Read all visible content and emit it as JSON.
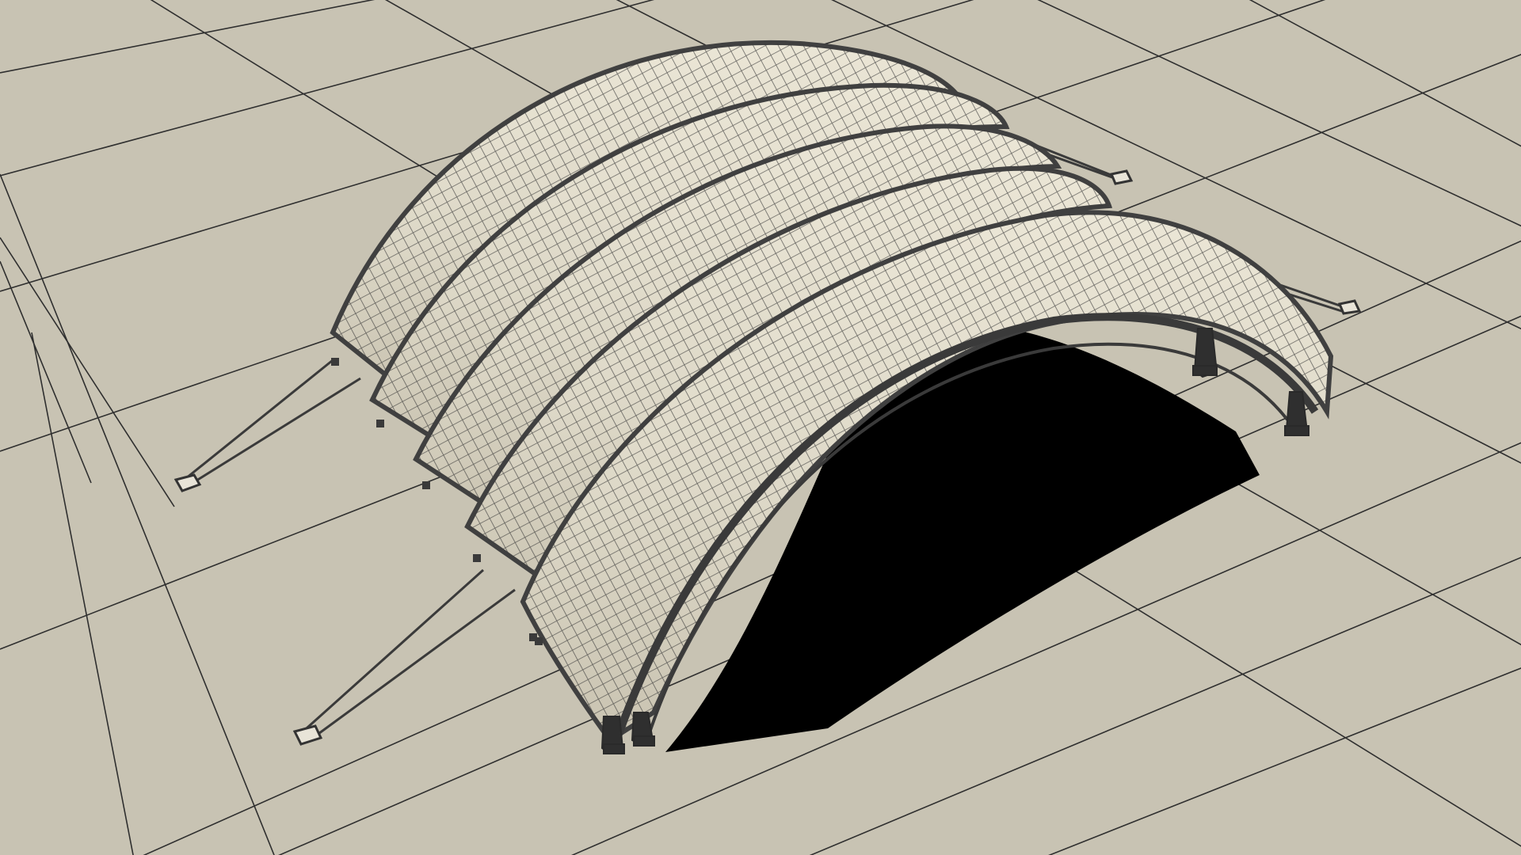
{
  "viewport": {
    "background_color": "#c8c3b3",
    "grid_line_color": "#2f2f2f",
    "shell_fill_color": "#ddd8c7",
    "shell_highlight_color": "#ebe6d6",
    "wireframe_color": "#3a3a3a",
    "edge_color": "#404040",
    "interior_shadow_color": "#000000"
  },
  "model": {
    "icon": "barrel-vault-canopy-wireframe",
    "shell_segments": 5,
    "support_legs_per_end": 2,
    "guy_cables": 4,
    "cable_anchors": 4
  }
}
